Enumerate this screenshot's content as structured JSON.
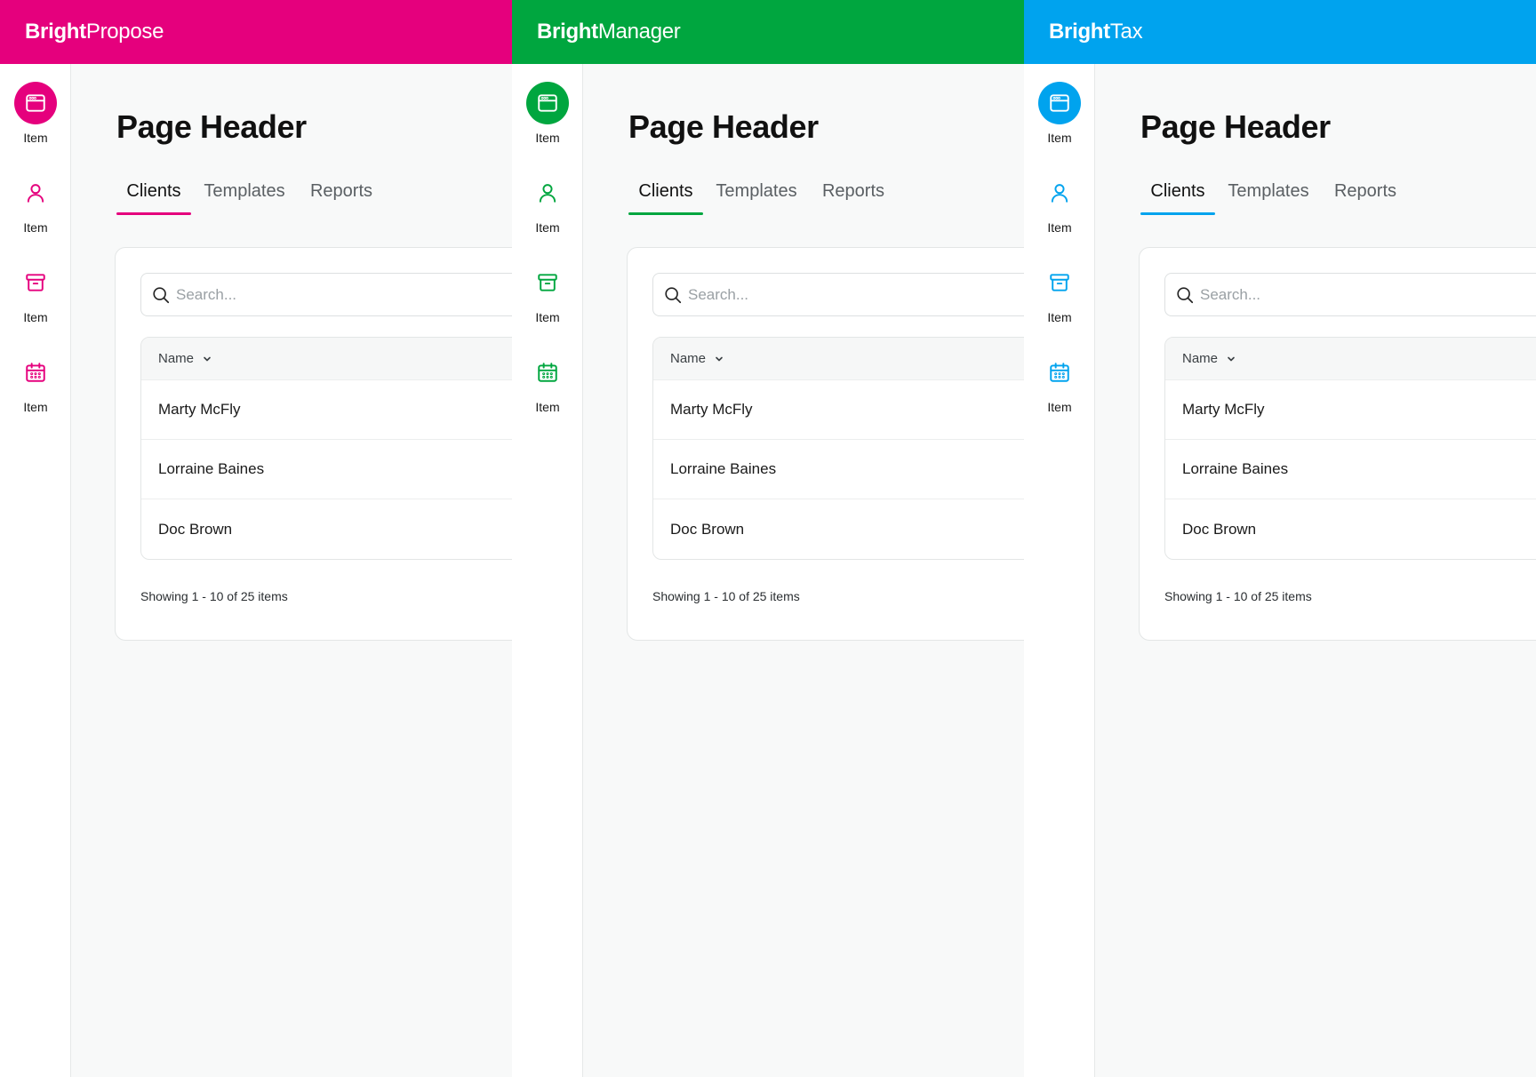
{
  "apps": [
    {
      "brand": {
        "bold": "Bright",
        "light": "Propose"
      },
      "accent": "#e5007d",
      "nav": [
        "Item",
        "Item",
        "Item",
        "Item"
      ],
      "page_title": "Page Header",
      "tabs": [
        "Clients",
        "Templates",
        "Reports"
      ],
      "search_placeholder": "Search...",
      "table": {
        "column": "Name",
        "rows": [
          "Marty McFly",
          "Lorraine Baines",
          "Doc Brown"
        ]
      },
      "pager": "Showing 1 - 10 of 25 items"
    },
    {
      "brand": {
        "bold": "Bright",
        "light": "Manager"
      },
      "accent": "#00a63f",
      "nav": [
        "Item",
        "Item",
        "Item",
        "Item"
      ],
      "page_title": "Page Header",
      "tabs": [
        "Clients",
        "Templates",
        "Reports"
      ],
      "search_placeholder": "Search...",
      "table": {
        "column": "Name",
        "rows": [
          "Marty McFly",
          "Lorraine Baines",
          "Doc Brown"
        ]
      },
      "pager": "Showing 1 - 10 of 25 items"
    },
    {
      "brand": {
        "bold": "Bright",
        "light": "Tax"
      },
      "accent": "#00a3ee",
      "nav": [
        "Item",
        "Item",
        "Item",
        "Item"
      ],
      "page_title": "Page Header",
      "tabs": [
        "Clients",
        "Templates",
        "Reports"
      ],
      "search_placeholder": "Search...",
      "table": {
        "column": "Name",
        "rows": [
          "Marty McFly",
          "Lorraine Baines",
          "Doc Brown"
        ]
      },
      "pager": "Showing 1 - 10 of 25 items"
    }
  ],
  "icons": {
    "nav": [
      "browser-window-icon",
      "user-icon",
      "archive-box-icon",
      "calendar-icon"
    ],
    "search": "search-icon",
    "sort": "chevron-down-icon"
  }
}
